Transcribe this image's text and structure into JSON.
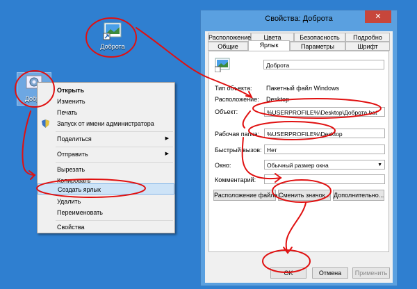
{
  "desktop": {
    "shortcut_label": "Доброта",
    "file_label": "Добро"
  },
  "context_menu": {
    "items": [
      {
        "label": "Открыть"
      },
      {
        "label": "Изменить"
      },
      {
        "label": "Печать"
      },
      {
        "label": "Запуск от имени администратора"
      },
      {
        "label": "Поделиться"
      },
      {
        "label": "Отправить"
      },
      {
        "label": "Вырезать"
      },
      {
        "label": "Копировать"
      },
      {
        "label": "Создать ярлык"
      },
      {
        "label": "Удалить"
      },
      {
        "label": "Переименовать"
      },
      {
        "label": "Свойства"
      }
    ]
  },
  "dialog": {
    "title": "Свойства: Доброта",
    "close": "✕",
    "tabs_row1": [
      "Расположение",
      "Цвета",
      "Безопасность",
      "Подробно"
    ],
    "tabs_row2": [
      "Общие",
      "Ярлык",
      "Параметры",
      "Шрифт"
    ],
    "shortcut_name": "Доброта",
    "fields": {
      "type_label": "Тип объекта:",
      "type_value": "Пакетный файл Windows",
      "location_label": "Расположение:",
      "location_value": "Desktop",
      "target_label": "Объект:",
      "target_value": "%USERPROFILE%\\Desktop\\Доброта.bat",
      "workdir_label": "Рабочая папка:",
      "workdir_value": "%USERPROFILE%\\Desktop",
      "hotkey_label": "Быстрый вызов:",
      "hotkey_value": "Нет",
      "window_label": "Окно:",
      "window_value": "Обычный размер окна",
      "comment_label": "Комментарий:",
      "comment_value": ""
    },
    "buttons": {
      "file_location": "Расположение файла",
      "change_icon": "Сменить значок...",
      "advanced": "Дополнительно...",
      "ok": "OK",
      "cancel": "Отмена",
      "apply": "Применить"
    }
  },
  "colors": {
    "desktop": "#2f7fd0",
    "annotation": "#e01010",
    "highlight": "#cde3f7"
  }
}
